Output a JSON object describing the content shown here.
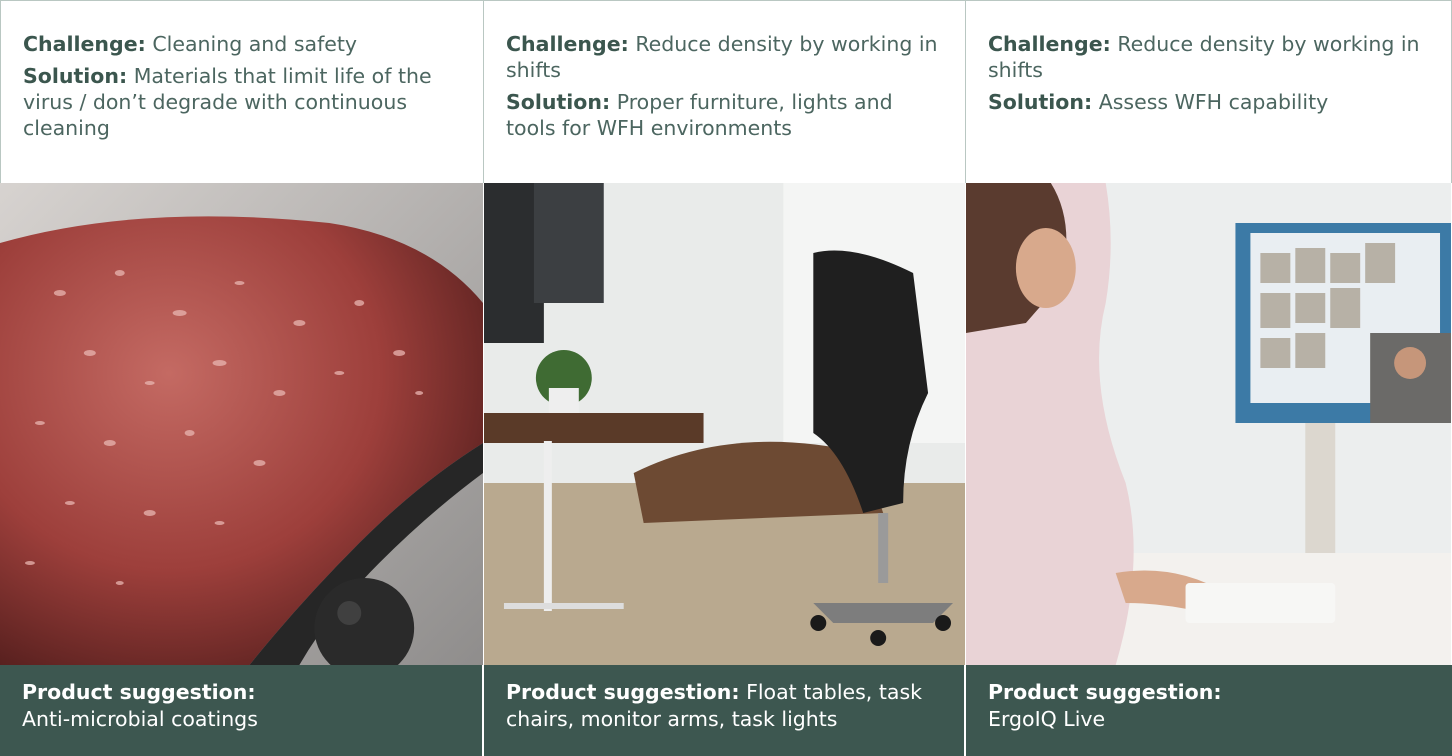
{
  "columns": [
    {
      "challenge_label": "Challenge:",
      "challenge_text": "Cleaning and safety",
      "solution_label": "Solution:",
      "solution_text": "Materials that limit life of the virus / don’t degrade with continuous cleaning",
      "product_label": "Product suggestion:",
      "product_text": "Anti-microbial coatings",
      "image_subject": "red-coated-surface-with-water-droplets"
    },
    {
      "challenge_label": "Challenge:",
      "challenge_text": " Reduce density by working in shifts",
      "solution_label": "Solution:",
      "solution_text": "Proper furniture, lights and tools for WFH environments",
      "product_label": "Product suggestion:",
      "product_text": " Float tables, task chairs, monitor arms, task lights",
      "image_subject": "home-office-desk-and-task-chair"
    },
    {
      "challenge_label": "Challenge:",
      "challenge_text": "Reduce density by working in shifts",
      "solution_label": "Solution:",
      "solution_text": "Assess WFH capability",
      "product_label": "Product suggestion:",
      "product_text": "ErgoIQ Live",
      "image_subject": "woman-on-video-call-at-monitor"
    }
  ],
  "colors": {
    "footer_bg": "#3d5750",
    "heading_text": "#3b564e",
    "body_text": "#4c6660",
    "border": "#b9c7c2"
  }
}
